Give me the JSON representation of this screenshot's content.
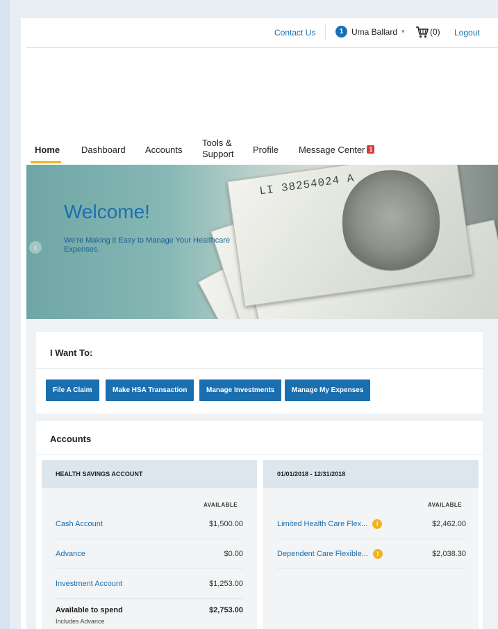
{
  "header": {
    "contact": "Contact Us",
    "user_initial": "1",
    "user_name": "Uma Ballard",
    "cart_count": "(0)",
    "logout": "Logout"
  },
  "nav": {
    "tabs": [
      "Home",
      "Dashboard",
      "Accounts",
      "Tools &",
      "Support",
      "Profile",
      "Message Center"
    ],
    "message_badge": "1"
  },
  "hero": {
    "serial": "LI 38254024 A",
    "title": "Welcome!",
    "tagline": "We're Making it Easy to Manage Your Healthcare Expenses."
  },
  "want": {
    "title": "I Want To:",
    "buttons": [
      "File A Claim",
      "Make HSA Transaction",
      "Manage Investments",
      "Manage My Expenses"
    ]
  },
  "accounts": {
    "title": "Accounts",
    "hsa": {
      "header": "HEALTH SAVINGS ACCOUNT",
      "available_label": "AVAILABLE",
      "rows": [
        {
          "name": "Cash Account",
          "amount": "$1,500.00"
        },
        {
          "name": "Advance",
          "amount": "$0.00"
        },
        {
          "name": "Investment Account",
          "amount": "$1,253.00"
        }
      ],
      "spend_label": "Available to spend",
      "spend_amount": "$2,753.00",
      "spend_note": "Includes Advance"
    },
    "fsa": {
      "header": "01/01/2018 - 12/31/2018",
      "available_label": "AVAILABLE",
      "rows": [
        {
          "name": "Limited Health Care Flex...",
          "amount": "$2,462.00"
        },
        {
          "name": "Dependent Care Flexible...",
          "amount": "$2,038.30"
        }
      ]
    }
  },
  "colors": {
    "accent": "#1a6fb0",
    "nav_underline": "#f0b323",
    "badge": "#d83a3a",
    "info": "#f0b323"
  }
}
